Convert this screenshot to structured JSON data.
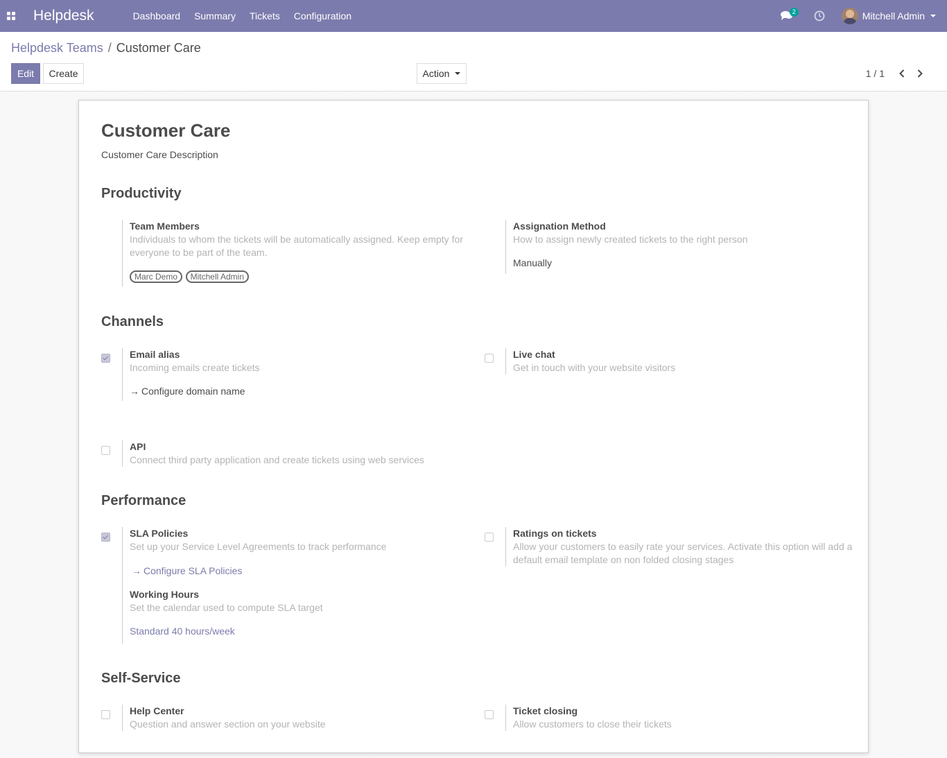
{
  "navbar": {
    "brand": "Helpdesk",
    "menu": [
      "Dashboard",
      "Summary",
      "Tickets",
      "Configuration"
    ],
    "chat_badge": "2",
    "user_name": "Mitchell Admin"
  },
  "control_panel": {
    "breadcrumb_parent": "Helpdesk Teams",
    "breadcrumb_separator": "/",
    "breadcrumb_current": "Customer Care",
    "edit_label": "Edit",
    "create_label": "Create",
    "action_label": "Action",
    "pager_value": "1 / 1"
  },
  "form": {
    "title": "Customer Care",
    "description": "Customer Care Description",
    "sections": {
      "productivity": "Productivity",
      "channels": "Channels",
      "performance": "Performance",
      "self_service": "Self-Service"
    },
    "team_members": {
      "label": "Team Members",
      "help_line1": "Individuals to whom the tickets will be automatically assigned. Keep empty for",
      "help_line2": "everyone to be part of the team.",
      "tags": [
        "Marc Demo",
        "Mitchell Admin"
      ]
    },
    "assignation": {
      "label": "Assignation Method",
      "help": "How to assign newly created tickets to the right person",
      "value": "Manually"
    },
    "email_alias": {
      "label": "Email alias",
      "help": "Incoming emails create tickets",
      "link": "Configure domain name",
      "checked": true
    },
    "live_chat": {
      "label": "Live chat",
      "help": "Get in touch with your website visitors",
      "checked": false
    },
    "api": {
      "label": "API",
      "help": "Connect third party application and create tickets using web services",
      "checked": false
    },
    "sla": {
      "label": "SLA Policies",
      "help": "Set up your Service Level Agreements to track performance",
      "link": "Configure SLA Policies",
      "checked": true
    },
    "working_hours": {
      "label": "Working Hours",
      "help": "Set the calendar used to compute SLA target",
      "value": "Standard 40 hours/week"
    },
    "ratings": {
      "label": "Ratings on tickets",
      "help_line1": "Allow your customers to easily rate your services. Activate this option will add a",
      "help_line2": "default email template on non folded closing stages",
      "checked": false
    },
    "help_center": {
      "label": "Help Center",
      "help": "Question and answer section on your website",
      "checked": false
    },
    "ticket_closing": {
      "label": "Ticket closing",
      "help": "Allow customers to close their tickets",
      "checked": false
    }
  },
  "colors": {
    "brand": "#7c7bad",
    "badge": "#00a09d"
  }
}
